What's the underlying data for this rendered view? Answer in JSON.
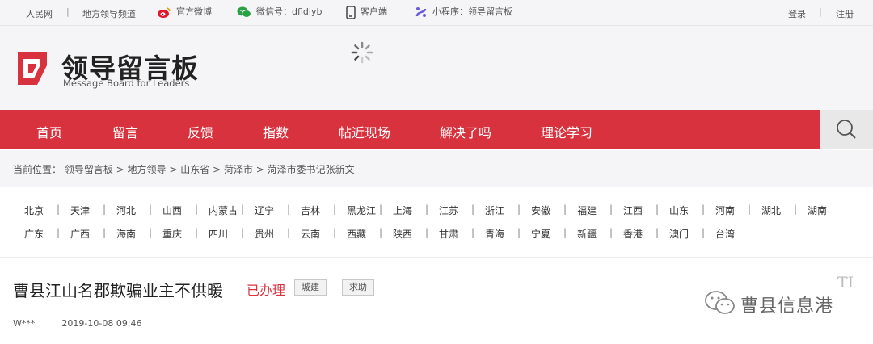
{
  "topbar": {
    "people_daily": "人民网",
    "local_leaders": "地方领导频道",
    "weibo": "官方微博",
    "wechat": "微信号：dfldlyb",
    "client": "客户端",
    "mini_program": "小程序：领导留言板",
    "login": "登录",
    "register": "注册",
    "separator": "|"
  },
  "header": {
    "logo_cn": "领导留言板",
    "logo_en": "Message Board for Leaders"
  },
  "nav": {
    "items": [
      "首页",
      "留言",
      "反馈",
      "指数",
      "帖近现场",
      "解决了吗",
      "理论学习"
    ]
  },
  "breadcrumb": {
    "prefix": "当前位置：",
    "items": [
      "领导留言板",
      "地方领导",
      "山东省",
      "菏泽市",
      "菏泽市委书记张新文"
    ],
    "arrow": " > "
  },
  "provinces": {
    "row1": [
      "北京",
      "天津",
      "河北",
      "山西",
      "内蒙古",
      "辽宁",
      "吉林",
      "黑龙江",
      "上海",
      "江苏",
      "浙江",
      "安徽",
      "福建",
      "江西",
      "山东",
      "河南",
      "湖北",
      "湖南"
    ],
    "row2": [
      "广东",
      "广西",
      "海南",
      "重庆",
      "四川",
      "贵州",
      "云南",
      "西藏",
      "陕西",
      "甘肃",
      "青海",
      "宁夏",
      "新疆",
      "香港",
      "澳门",
      "台湾"
    ],
    "separator": "|"
  },
  "message": {
    "title": "曹县江山名郡欺骗业主不供暖",
    "status": "已办理",
    "tags": [
      "城建",
      "求助"
    ],
    "author": "W***",
    "datetime": "2019-10-08 09:46"
  },
  "watermark": {
    "text": "曹县信息港",
    "corner": "TI"
  },
  "colors": {
    "brand_red": "#d9323f",
    "header_bg": "#f5f4f6",
    "search_bg": "#e8e8e8"
  },
  "icons": {
    "weibo": "weibo-icon",
    "wechat": "wechat-icon",
    "client": "phone-icon",
    "mini_program": "mini-program-icon",
    "search": "search-icon",
    "loading": "loading-spinner-icon"
  }
}
